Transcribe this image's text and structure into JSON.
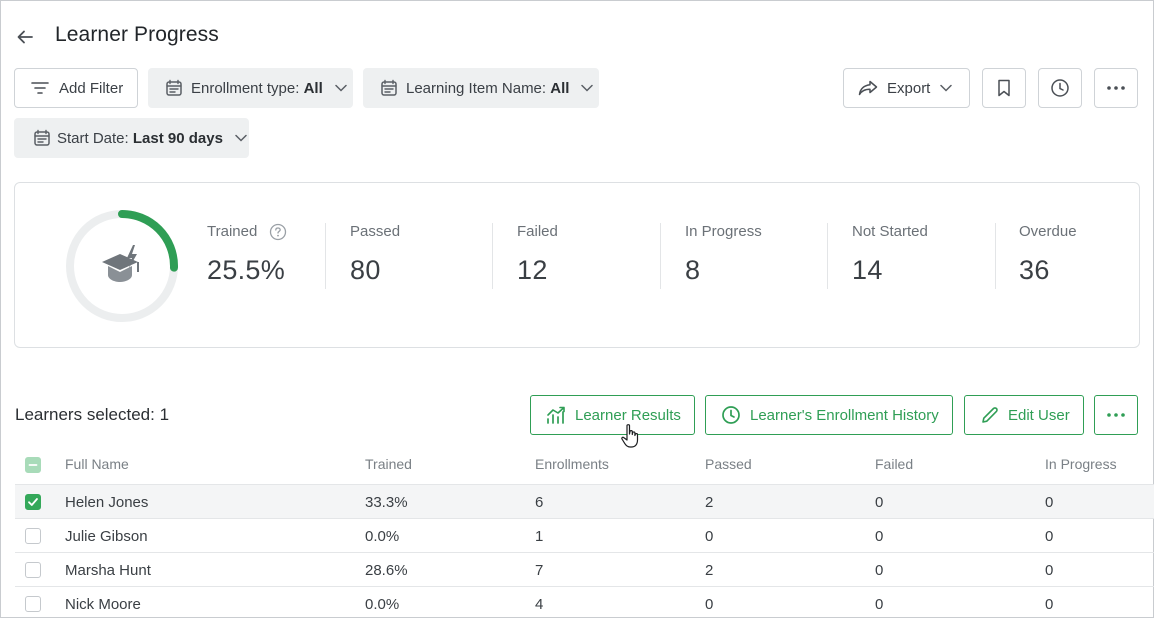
{
  "header": {
    "title": "Learner Progress",
    "back_icon": "arrow-left-icon"
  },
  "filters": {
    "add_filter": "Add Filter",
    "enrollment_type_label": "Enrollment type:",
    "enrollment_type_value": "All",
    "learning_item_label": "Learning Item Name:",
    "learning_item_value": "All",
    "start_date_label": "Start Date:",
    "start_date_value": "Last 90 days"
  },
  "toolbar": {
    "export_label": "Export"
  },
  "stats": {
    "trained_progress": 0.255,
    "items": [
      {
        "label": "Trained",
        "value": "25.5%"
      },
      {
        "label": "Passed",
        "value": "80"
      },
      {
        "label": "Failed",
        "value": "12"
      },
      {
        "label": "In Progress",
        "value": "8"
      },
      {
        "label": "Not Started",
        "value": "14"
      },
      {
        "label": "Overdue",
        "value": "36"
      }
    ]
  },
  "selection": {
    "label": "Learners selected: 1",
    "learner_results": "Learner Results",
    "enrollment_history": "Learner's Enrollment History",
    "edit_user": "Edit User"
  },
  "table": {
    "columns": [
      "Full Name",
      "Trained",
      "Enrollments",
      "Passed",
      "Failed",
      "In Progress"
    ],
    "rows": [
      {
        "name": "Helen Jones",
        "trained": "33.3%",
        "enrollments": "6",
        "passed": "2",
        "failed": "0",
        "in_progress": "0",
        "selected": true
      },
      {
        "name": "Julie Gibson",
        "trained": "0.0%",
        "enrollments": "1",
        "passed": "0",
        "failed": "0",
        "in_progress": "0",
        "selected": false
      },
      {
        "name": "Marsha Hunt",
        "trained": "28.6%",
        "enrollments": "7",
        "passed": "2",
        "failed": "0",
        "in_progress": "0",
        "selected": false
      },
      {
        "name": "Nick Moore",
        "trained": "0.0%",
        "enrollments": "4",
        "passed": "0",
        "failed": "0",
        "in_progress": "0",
        "selected": false
      }
    ]
  },
  "colors": {
    "accent_green": "#2f9e55",
    "ring_track": "#eceeef"
  }
}
